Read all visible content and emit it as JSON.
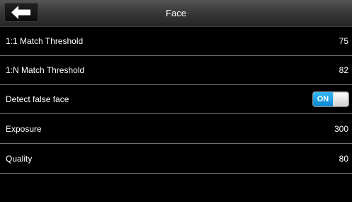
{
  "header": {
    "title": "Face",
    "back_icon": "back-arrow-icon"
  },
  "rows": [
    {
      "label": "1:1 Match Threshold",
      "value": "75"
    },
    {
      "label": "1:N Match Threshold",
      "value": "82"
    },
    {
      "label": "Detect false face",
      "toggle_label": "ON",
      "toggle_on": true
    },
    {
      "label": "Exposure",
      "value": "300"
    },
    {
      "label": "Quality",
      "value": "80"
    }
  ],
  "colors": {
    "background": "#000000",
    "toggle_on": "#1a9ee6",
    "divider": "#6e6e6e"
  }
}
